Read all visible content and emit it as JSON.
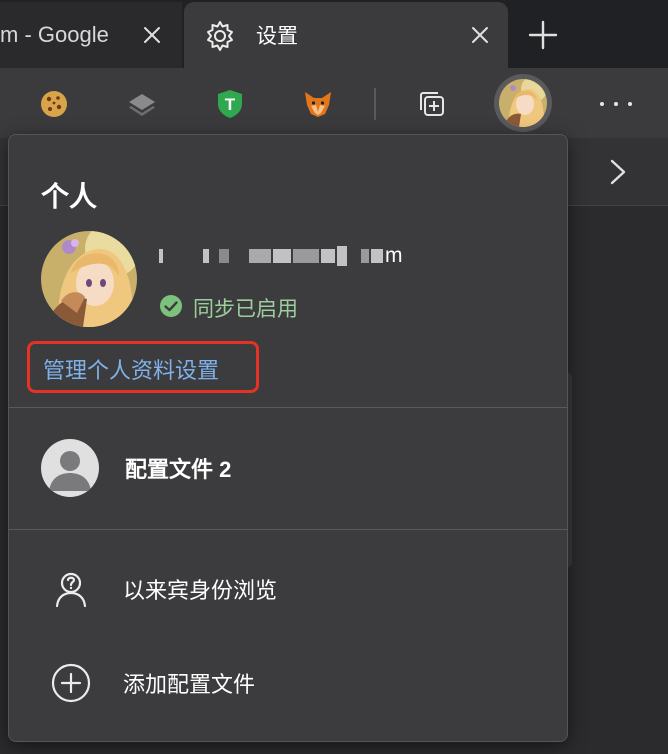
{
  "tabs": [
    {
      "title": "m - Google",
      "active": false
    },
    {
      "title": "设置",
      "active": true
    }
  ],
  "icons": {
    "settings_tab": "gear-icon",
    "new_tab": "plus-icon",
    "cookie_ext": "cookie-icon",
    "layers_ext": "layers-icon",
    "shield_ext": "shield-icon",
    "fox_ext": "fox-icon",
    "collections": "collections-icon",
    "more": "more-icon",
    "sync_ok": "check-circle-icon",
    "guest": "guest-icon",
    "add": "add-circle-icon",
    "chevron": "chevron-right-icon"
  },
  "toolbar": {
    "shield_letter": "T"
  },
  "panel": {
    "heading": "个人",
    "email_tail": "m",
    "sync_status": "同步已启用",
    "manage_link": "管理个人资料设置",
    "other_profile": "配置文件 2",
    "guest_label": "以来宾身份浏览",
    "add_profile": "添加配置文件"
  },
  "colors": {
    "accent_link": "#7fb2ea",
    "sync_green": "#9ccf9c",
    "highlight_red": "#e53224",
    "panel_bg": "#3c3c3e",
    "toolbar_bg": "#3b3b3d"
  }
}
